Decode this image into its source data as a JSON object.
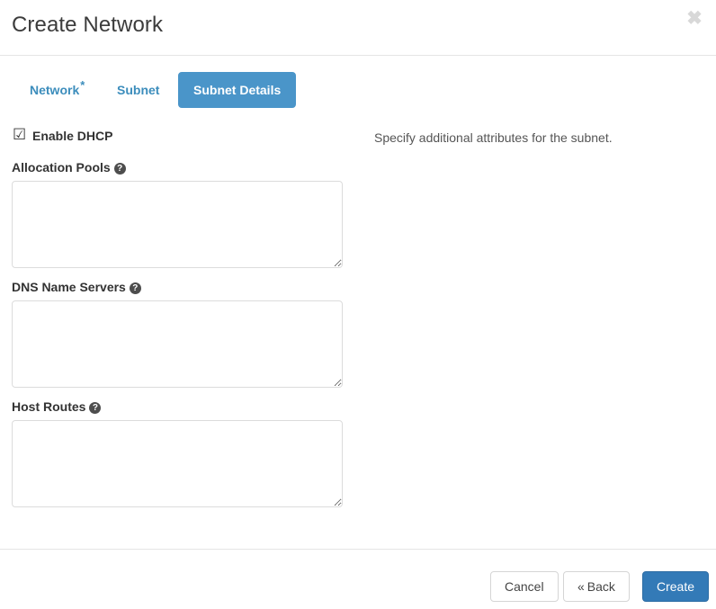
{
  "modal": {
    "title": "Create Network",
    "close_icon": "close-icon",
    "close_glyph": "✖"
  },
  "tabs": [
    {
      "label": "Network",
      "required_marker": "*",
      "active": false
    },
    {
      "label": "Subnet",
      "required_marker": "",
      "active": false
    },
    {
      "label": "Subnet Details",
      "required_marker": "",
      "active": true
    }
  ],
  "form": {
    "enable_dhcp": {
      "label": "Enable DHCP",
      "checked": true,
      "glyph": "☑"
    },
    "fields": [
      {
        "label": "Allocation Pools",
        "help_glyph": "?",
        "value": "",
        "placeholder": ""
      },
      {
        "label": "DNS Name Servers",
        "help_glyph": "?",
        "value": "",
        "placeholder": ""
      },
      {
        "label": "Host Routes",
        "help_glyph": "?",
        "value": "",
        "placeholder": ""
      }
    ]
  },
  "help_panel": {
    "text": "Specify additional attributes for the subnet."
  },
  "footer": {
    "cancel_label": "Cancel",
    "back_guillemet": "«",
    "back_label": "Back",
    "create_label": "Create"
  },
  "colors": {
    "tab_active_bg": "#4a95c9",
    "link_blue": "#3c8dbc",
    "primary_button_bg": "#337ab7",
    "border_gray": "#e5e5e5",
    "input_border": "#dcdcdc"
  }
}
